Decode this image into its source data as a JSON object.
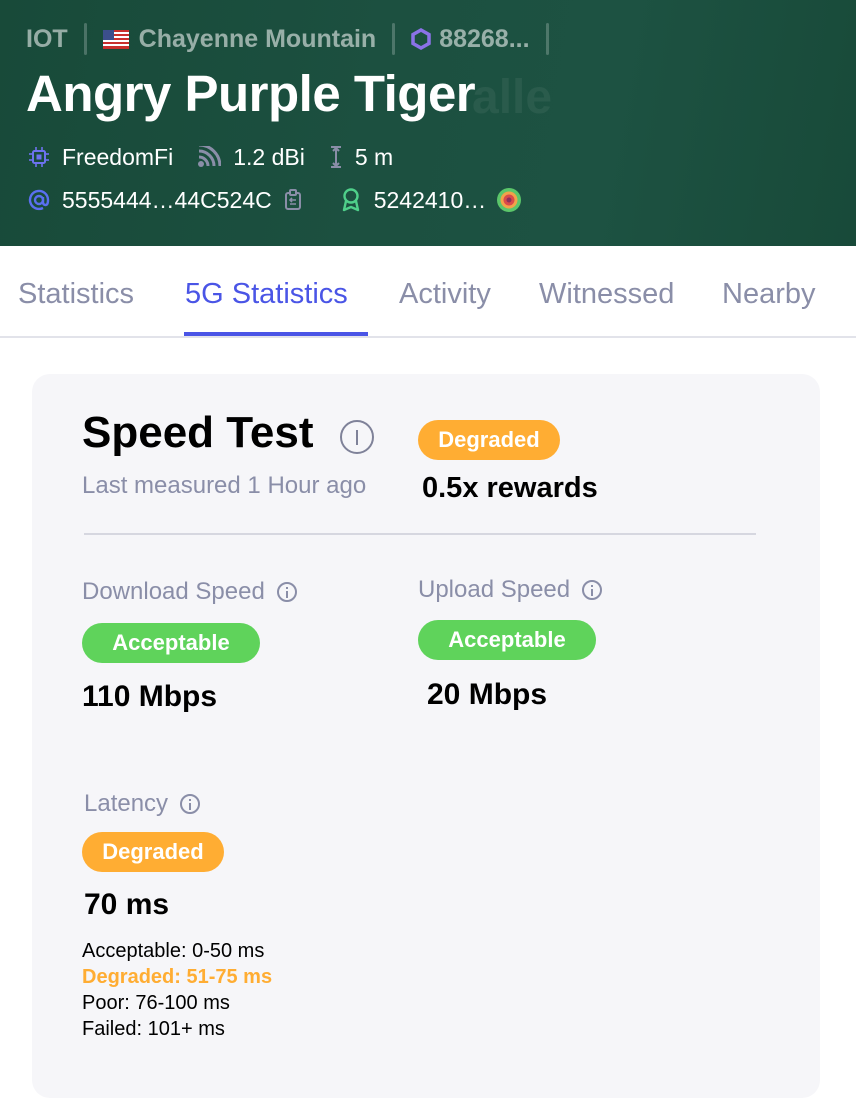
{
  "header": {
    "network": "IOT",
    "location": "Chayenne Mountain",
    "location_flag_icon": "us-flag-icon",
    "hex_id": "88268...",
    "hotspot_name": "Angry Purple Tiger",
    "maker": "FreedomFi",
    "antenna_gain": "1.2 dBi",
    "elevation": "5 m",
    "owner_address": "5555444…44C524C",
    "reward_address": "5242410…",
    "colors": {
      "background": "#1c5040",
      "accent": "#4a55e6"
    }
  },
  "tabs": [
    {
      "label": "Statistics",
      "active": false
    },
    {
      "label": "5G Statistics",
      "active": true
    },
    {
      "label": "Activity",
      "active": false
    },
    {
      "label": "Witnessed",
      "active": false
    },
    {
      "label": "Nearby",
      "active": false
    }
  ],
  "speed_test": {
    "title": "Speed Test",
    "last_measured": "Last measured 1 Hour ago",
    "overall_status": "Degraded",
    "rewards": "0.5x rewards",
    "download": {
      "label": "Download Speed",
      "status": "Acceptable",
      "value": "110 Mbps"
    },
    "upload": {
      "label": "Upload Speed",
      "status": "Acceptable",
      "value": "20 Mbps"
    },
    "latency": {
      "label": "Latency",
      "status": "Degraded",
      "value": "70 ms"
    },
    "thresholds": [
      "Acceptable: 0-50 ms",
      "Degraded: 51-75 ms",
      "Poor: 76-100 ms",
      "Failed: 101+ ms"
    ],
    "colors": {
      "degraded": "#ffad33",
      "acceptable": "#5fd35b"
    }
  }
}
